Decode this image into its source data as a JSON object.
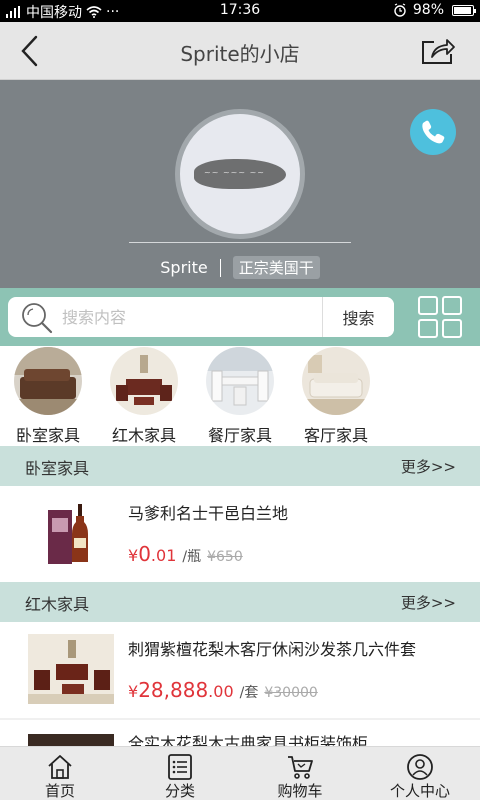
{
  "status_bar": {
    "signal_icon": "signal-icon",
    "carrier": "中国移动",
    "wifi_icon": "wifi-icon",
    "dots": "···",
    "time": "17:36",
    "alarm_icon": "alarm-icon",
    "battery_percent": "98%",
    "battery_icon": "battery-icon"
  },
  "header": {
    "title": "Sprite的小店",
    "back_icon": "chevron-left-icon",
    "share_icon": "share-icon"
  },
  "shop": {
    "name": "Sprite",
    "tag": "正宗美国干",
    "logo": "shop-logo",
    "call_icon": "phone-icon",
    "banner_color": "#7c8286",
    "call_color": "#4ec0dd"
  },
  "search": {
    "placeholder": "搜索内容",
    "button_label": "搜索",
    "search_icon": "search-icon",
    "grid_icon": "grid-icon",
    "bar_color": "#8dc3b4"
  },
  "categories": [
    {
      "label": "卧室家具",
      "image": "bedroom-furniture-thumb"
    },
    {
      "label": "红木家具",
      "image": "rosewood-furniture-thumb"
    },
    {
      "label": "餐厅家具",
      "image": "dining-furniture-thumb"
    },
    {
      "label": "客厅家具",
      "image": "living-room-furniture-thumb"
    }
  ],
  "sections": [
    {
      "title": "卧室家具",
      "more": "更多>>",
      "products": [
        {
          "name": "马爹利名士干邑白兰地",
          "currency": "¥",
          "price_int": "0",
          "price_dec": ".01",
          "unit": "/瓶",
          "old_price": "¥650",
          "image": "brandy-bottle-thumb"
        }
      ]
    },
    {
      "title": "红木家具",
      "more": "更多>>",
      "products": [
        {
          "name": "刺猬紫檀花梨木客厅休闲沙发茶几六件套",
          "currency": "¥",
          "price_int": "28,888",
          "price_dec": ".00",
          "unit": "/套",
          "old_price": "¥30000",
          "image": "rosewood-sofa-set-thumb"
        },
        {
          "name": "全实木花梨木古典家具书柜装饰柜",
          "image": "rosewood-cabinet-thumb"
        }
      ]
    }
  ],
  "bottom_nav": [
    {
      "label": "首页",
      "icon": "home-icon"
    },
    {
      "label": "分类",
      "icon": "list-icon"
    },
    {
      "label": "购物车",
      "icon": "cart-icon"
    },
    {
      "label": "个人中心",
      "icon": "user-icon"
    }
  ],
  "colors": {
    "accent": "#8dc3b4",
    "section_header": "#c9e0db",
    "price": "#e0343a"
  }
}
